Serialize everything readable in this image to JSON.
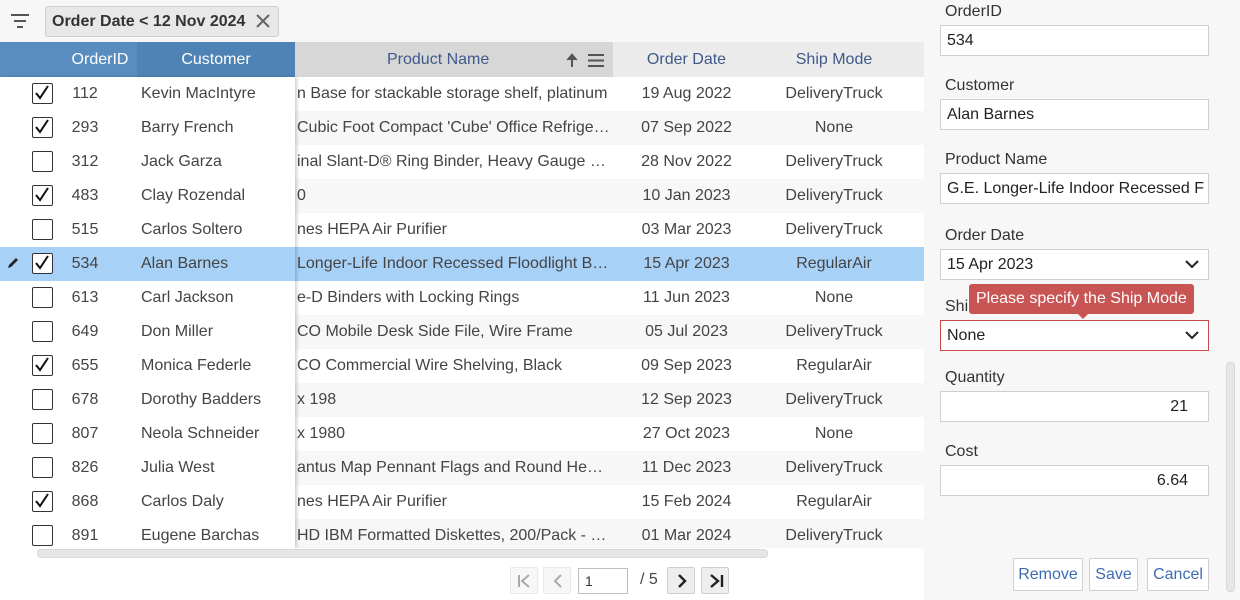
{
  "filter": {
    "icon": "filter-icon",
    "chip_label": "Order Date < 12 Nov 2024",
    "close_icon": "close-icon"
  },
  "grid": {
    "columns": {
      "order_id": "OrderID",
      "customer": "Customer",
      "product_name": "Product Name",
      "order_date": "Order Date",
      "ship_mode": "Ship Mode"
    },
    "rows": [
      {
        "checked": true,
        "id": "112",
        "customer": "Kevin MacIntyre",
        "product": "n Base for stackable storage shelf, platinum",
        "date": "19 Aug 2022",
        "ship": "DeliveryTruck"
      },
      {
        "checked": true,
        "id": "293",
        "customer": "Barry French",
        "product": "Cubic Foot Compact 'Cube' Office Refriger…",
        "date": "07 Sep 2022",
        "ship": "None"
      },
      {
        "checked": false,
        "id": "312",
        "customer": "Jack Garza",
        "product": "inal Slant-D® Ring Binder, Heavy Gauge …",
        "date": "28 Nov 2022",
        "ship": "DeliveryTruck"
      },
      {
        "checked": true,
        "id": "483",
        "customer": "Clay Rozendal",
        "product": "0",
        "date": "10 Jan 2023",
        "ship": "DeliveryTruck"
      },
      {
        "checked": false,
        "id": "515",
        "customer": "Carlos Soltero",
        "product": "nes HEPA Air Purifier",
        "date": "03 Mar 2023",
        "ship": "DeliveryTruck"
      },
      {
        "checked": true,
        "id": "534",
        "customer": "Alan Barnes",
        "product": " Longer-Life Indoor Recessed Floodlight B…",
        "date": "15 Apr 2023",
        "ship": "RegularAir"
      },
      {
        "checked": false,
        "id": "613",
        "customer": "Carl Jackson",
        "product": "e-D Binders with Locking Rings",
        "date": "11 Jun 2023",
        "ship": "None"
      },
      {
        "checked": false,
        "id": "649",
        "customer": "Don Miller",
        "product": "CO Mobile Desk Side File, Wire Frame",
        "date": "05 Jul 2023",
        "ship": "DeliveryTruck"
      },
      {
        "checked": true,
        "id": "655",
        "customer": "Monica Federle",
        "product": "CO Commercial Wire Shelving, Black",
        "date": "09 Sep 2023",
        "ship": "RegularAir"
      },
      {
        "checked": false,
        "id": "678",
        "customer": "Dorothy Badders",
        "product": "x 198",
        "date": "12 Sep 2023",
        "ship": "DeliveryTruck"
      },
      {
        "checked": false,
        "id": "807",
        "customer": "Neola Schneider",
        "product": "x 1980",
        "date": "27 Oct 2023",
        "ship": "None"
      },
      {
        "checked": false,
        "id": "826",
        "customer": "Julia West",
        "product": "antus Map Pennant Flags and Round Hea…",
        "date": "11 Dec 2023",
        "ship": "DeliveryTruck"
      },
      {
        "checked": true,
        "id": "868",
        "customer": "Carlos Daly",
        "product": "nes HEPA Air Purifier",
        "date": "15 Feb 2024",
        "ship": "RegularAir"
      },
      {
        "checked": false,
        "id": "891",
        "customer": "Eugene Barchas",
        "product": "HD IBM Formatted Diskettes, 200/Pack - S…",
        "date": "01 Mar 2024",
        "ship": "DeliveryTruck"
      }
    ],
    "selected_index": 5
  },
  "pager": {
    "current_page": "1",
    "total_label": "/ 5"
  },
  "form": {
    "order_id": {
      "label": "OrderID",
      "value": "534"
    },
    "customer": {
      "label": "Customer",
      "value": "Alan Barnes"
    },
    "product_name": {
      "label": "Product Name",
      "value": "G.E. Longer-Life Indoor Recessed F"
    },
    "order_date": {
      "label": "Order Date",
      "value": "15 Apr 2023"
    },
    "ship_mode": {
      "label": "Shi",
      "value": "None",
      "error": "Please specify the Ship Mode"
    },
    "quantity": {
      "label": "Quantity",
      "value": "21"
    },
    "cost": {
      "label": "Cost",
      "value": "6.64"
    },
    "buttons": {
      "remove": "Remove",
      "save": "Save",
      "cancel": "Cancel"
    }
  },
  "colors": {
    "header_frozen": "#5a8dbf",
    "selected_row": "#a8d1f7",
    "link": "#3d6bb3",
    "error": "#c95454"
  }
}
